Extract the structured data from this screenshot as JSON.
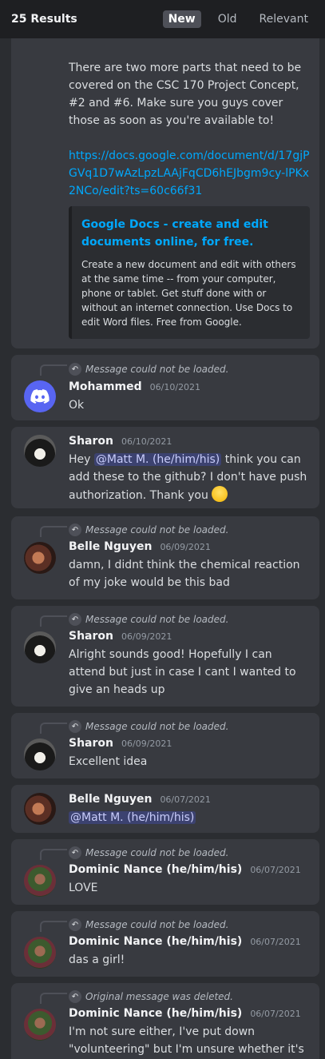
{
  "header": {
    "results": "25 Results",
    "tabs": [
      {
        "label": "New",
        "active": true
      },
      {
        "label": "Old",
        "active": false
      },
      {
        "label": "Relevant",
        "active": false
      }
    ]
  },
  "first": {
    "text": "There are two more parts that need to be covered on the CSC 170 Project Concept, #2 and #6. Make sure you guys cover those as soon as you're available to!",
    "link": "https://docs.google.com/document/d/17gjPGVq1D7wAzLpzLAAjFqCD6hEJbgm9cy-lPKx2NCo/edit?ts=60c66f31",
    "embed_title": "Google Docs - create and edit documents online, for free.",
    "embed_desc": "Create a new document and edit with others at the same time -- from your computer, phone or tablet. Get stuff done with or without an internet connection. Use Docs to edit Word files. Free from Google."
  },
  "messages": [
    {
      "reply": "Message could not be loaded.",
      "name": "Mohammed",
      "date": "06/10/2021",
      "text": "Ok"
    },
    {
      "name": "Sharon",
      "date": "06/10/2021",
      "pre": "Hey",
      "mention": "@Matt M. (he/him/his)",
      "post": "think you can add these to the github? I don't have push authorization. Thank you"
    },
    {
      "reply": "Message could not be loaded.",
      "name": "Belle Nguyen",
      "date": "06/09/2021",
      "text": "damn, I didnt think the chemical reaction of my joke would be this bad"
    },
    {
      "reply": "Message could not be loaded.",
      "name": "Sharon",
      "date": "06/09/2021",
      "text": "Alright sounds good! Hopefully I can attend but just in case I cant I wanted to give an heads up"
    },
    {
      "reply": "Message could not be loaded.",
      "name": "Sharon",
      "date": "06/09/2021",
      "text": "Excellent idea"
    },
    {
      "name": "Belle Nguyen",
      "date": "06/07/2021",
      "mention": "@Matt M. (he/him/his)"
    },
    {
      "reply": "Message could not be loaded.",
      "name": "Dominic Nance (he/him/his)",
      "date": "06/07/2021",
      "text": "LOVE"
    },
    {
      "reply": "Message could not be loaded.",
      "name": "Dominic Nance (he/him/his)",
      "date": "06/07/2021",
      "text": "das a girl!"
    },
    {
      "reply": "Original message was deleted.",
      "name": "Dominic Nance (he/him/his)",
      "date": "06/07/2021",
      "text": "I'm not sure either, I've put down \"volunteering\" but I'm unsure whether it's"
    }
  ]
}
